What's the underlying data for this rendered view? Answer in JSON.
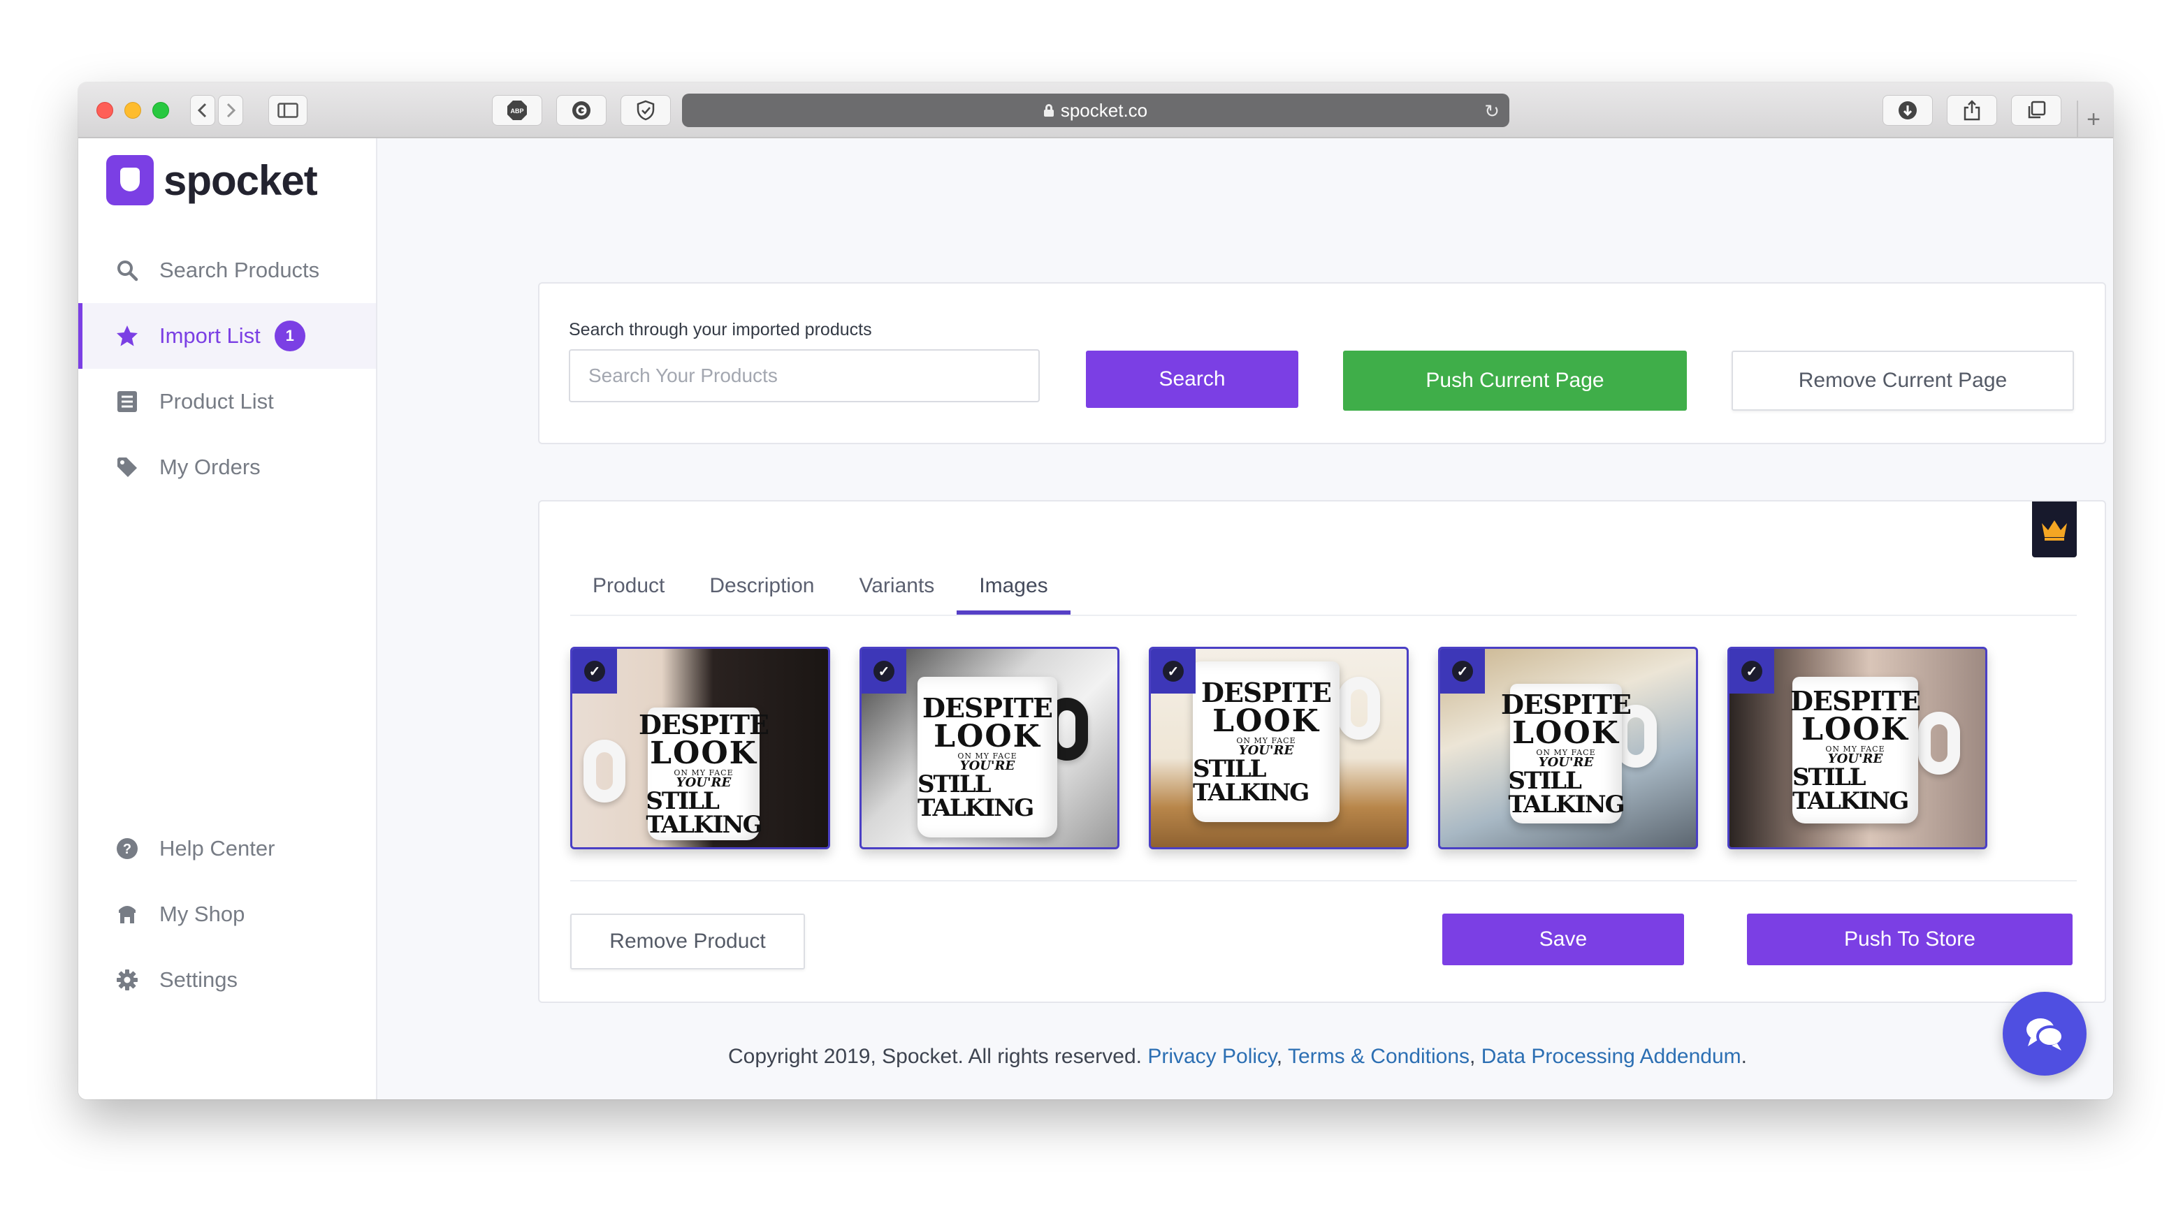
{
  "browser": {
    "url": "spocket.co",
    "reload_icon": "reload-icon"
  },
  "brand": {
    "name": "spocket",
    "accent": "#7b3fe4"
  },
  "sidebar": {
    "items": [
      {
        "label": "Search Products",
        "icon": "search-icon"
      },
      {
        "label": "Import List",
        "icon": "star-icon",
        "badge": "1",
        "active": true
      },
      {
        "label": "Product List",
        "icon": "list-icon"
      },
      {
        "label": "My Orders",
        "icon": "tag-icon"
      }
    ],
    "bottom_items": [
      {
        "label": "Help Center",
        "icon": "help-icon"
      },
      {
        "label": "My Shop",
        "icon": "shop-icon"
      },
      {
        "label": "Settings",
        "icon": "gear-icon"
      }
    ]
  },
  "search": {
    "label": "Search through your imported products",
    "placeholder": "Search Your Products",
    "value": "",
    "search_button": "Search",
    "push_page_button": "Push Current Page",
    "remove_page_button": "Remove Current Page"
  },
  "product": {
    "tabs": [
      "Product",
      "Description",
      "Variants",
      "Images"
    ],
    "active_tab": "Images",
    "images": [
      {
        "text": [
          "DESPITE",
          "LOOK",
          "ON MY FACE",
          "YOU'RE",
          "STILL TALKING"
        ],
        "selected": true
      },
      {
        "text": [
          "DESPITE",
          "LOOK",
          "ON MY FACE",
          "YOU'RE",
          "STILL TALKING"
        ],
        "selected": true
      },
      {
        "text": [
          "DESPITE",
          "LOOK",
          "ON MY FACE",
          "YOU'RE",
          "STILL TALKING"
        ],
        "selected": true
      },
      {
        "text": [
          "DESPITE",
          "LOOK",
          "ON MY FACE",
          "YOU'RE",
          "STILL TALKING"
        ],
        "selected": true
      },
      {
        "text": [
          "DESPITE",
          "LOOK",
          "ON MY FACE",
          "YOU'RE",
          "STILL TALKING"
        ],
        "selected": true
      }
    ],
    "remove_button": "Remove Product",
    "save_button": "Save",
    "push_button": "Push To Store"
  },
  "footer": {
    "copyright": "Copyright 2019, Spocket. All rights reserved. ",
    "privacy": "Privacy Policy",
    "sep1": ", ",
    "terms": "Terms & Conditions",
    "sep2": ", ",
    "dpa": "Data Processing Addendum",
    "end": "."
  },
  "colors": {
    "green": "#3fae49",
    "navy": "#17192c",
    "link": "#2c6fb3"
  }
}
